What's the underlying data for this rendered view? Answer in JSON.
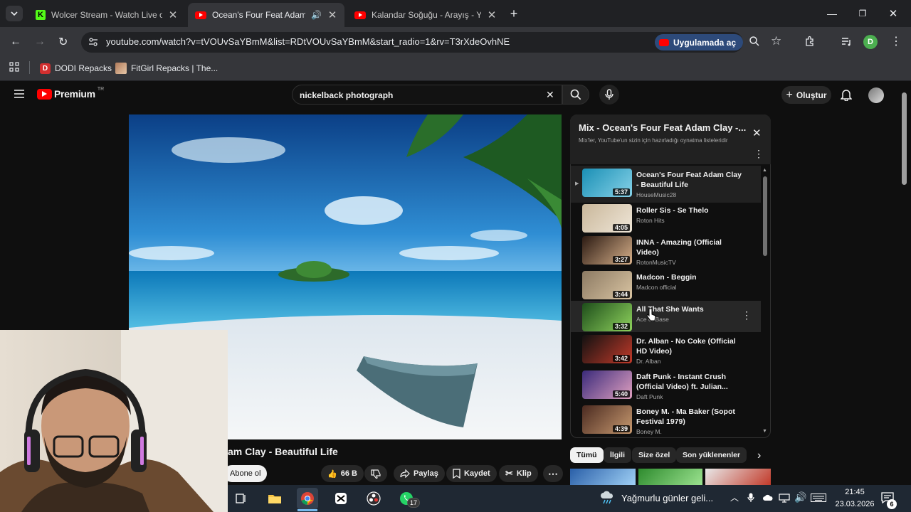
{
  "tabs": [
    {
      "title": "Wolcer Stream - Watch Live on",
      "icon": "kick-icon"
    },
    {
      "title": "Ocean's Four Feat Adam Cl",
      "icon": "youtube-icon",
      "audio": true
    },
    {
      "title": "Kalandar Soğuğu - Arayış - You",
      "icon": "youtube-icon"
    }
  ],
  "address": {
    "url": "youtube.com/watch?v=tVOUvSaYBmM&list=RDtVOUvSaYBmM&start_radio=1&rv=T3rXdeOvhNE",
    "open_in_app": "Uygulamada aç",
    "profile_initial": "D"
  },
  "bookmarks": [
    {
      "label": "DODI Repacks",
      "icon_letter": "D"
    },
    {
      "label": "FitGirl Repacks | The..."
    }
  ],
  "youtube": {
    "logo_text": "Premium",
    "logo_sup": "TR",
    "search_value": "nickelback photograph",
    "create_label": "Oluştur"
  },
  "video": {
    "title_visible": "am Clay - Beautiful Life",
    "subscribe": "Abone ol",
    "likes": "66 B",
    "share": "Paylaş",
    "save": "Kaydet",
    "clip": "Klip"
  },
  "playlist": {
    "title": "Mix - Ocean's Four Feat Adam Clay -...",
    "subtitle": "Mix'ler, YouTube'un sizin için hazırladığı oynatma listeleridir",
    "items": [
      {
        "title": "Ocean's Four Feat Adam Clay - Beautiful Life",
        "channel": "HouseMusic28",
        "duration": "5:37",
        "playing": true,
        "colors": [
          "#1a8fb5",
          "#86d2e8"
        ]
      },
      {
        "title": "Roller Sis - Se Thelo",
        "channel": "Roton Hits",
        "duration": "4:05",
        "colors": [
          "#c9b79a",
          "#efe6d8"
        ]
      },
      {
        "title": "INNA - Amazing (Official Video)",
        "channel": "RotonMusicTV",
        "duration": "3:27",
        "colors": [
          "#2b1a12",
          "#d7b08a"
        ]
      },
      {
        "title": "Madcon - Beggin",
        "channel": "Madcon official",
        "duration": "3:44",
        "colors": [
          "#8c7a63",
          "#d9c4a2"
        ]
      },
      {
        "title": "All That She Wants",
        "channel": "Ace of Base",
        "duration": "3:32",
        "colors": [
          "#1d4d1a",
          "#8fd35d"
        ],
        "hovered": true
      },
      {
        "title": "Dr. Alban - No Coke (Official HD Video)",
        "channel": "Dr. Alban",
        "duration": "3:42",
        "colors": [
          "#111111",
          "#c23a2a"
        ]
      },
      {
        "title": "Daft Punk - Instant Crush (Official Video) ft. Julian...",
        "channel": "Daft Punk",
        "duration": "5:40",
        "colors": [
          "#3a2a7a",
          "#e0a0c0"
        ]
      },
      {
        "title": "Boney M. - Ma Baker (Sopot Festival 1979)",
        "channel": "Boney M.",
        "duration": "4:39",
        "colors": [
          "#4a2a20",
          "#c89a70"
        ]
      }
    ]
  },
  "chips": [
    "Tümü",
    "İlgili",
    "Size özel",
    "Son yüklenenler"
  ],
  "taskbar": {
    "weather": "Yağmurlu günler geli...",
    "time": "21:45",
    "date": "23.03.2026",
    "whatsapp_badge": "17",
    "notif_badge": "6"
  }
}
